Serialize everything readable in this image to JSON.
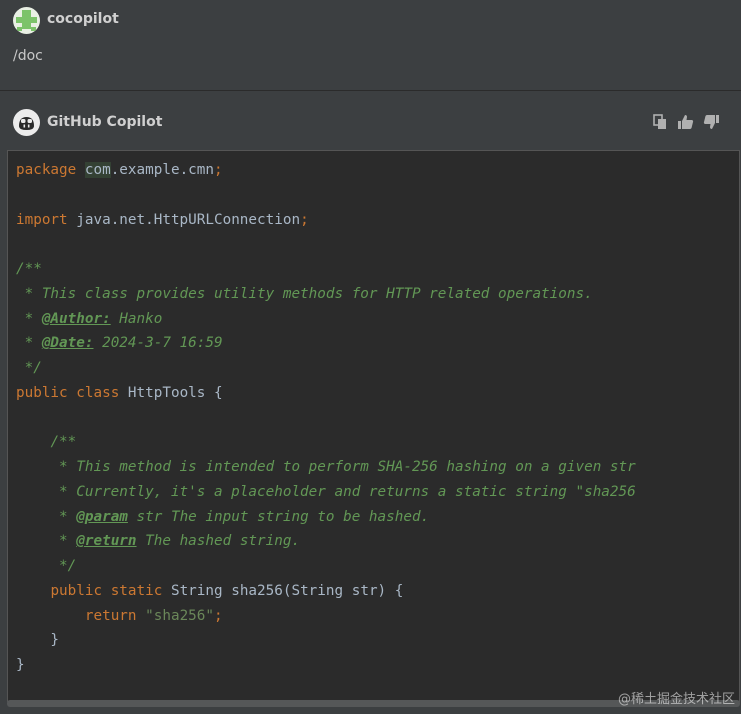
{
  "user": {
    "name": "cocopilot",
    "message": "/doc"
  },
  "assistant": {
    "name": "GitHub Copilot",
    "actions": [
      "copy-icon",
      "thumbs-up-icon",
      "thumbs-down-icon"
    ]
  },
  "code": {
    "language": "java",
    "lines": [
      [
        {
          "t": "package",
          "c": "kw"
        },
        {
          "t": " "
        },
        {
          "t": "com",
          "c": "hl"
        },
        {
          "t": ".example.cmn"
        },
        {
          "t": ";",
          "c": "kw"
        }
      ],
      [],
      [
        {
          "t": "import",
          "c": "kw"
        },
        {
          "t": " java.net.HttpURLConnection"
        },
        {
          "t": ";",
          "c": "kw"
        }
      ],
      [],
      [
        {
          "t": "/**",
          "c": "cm"
        }
      ],
      [
        {
          "t": " * This class provides utility methods for HTTP related operations.",
          "c": "cm"
        }
      ],
      [
        {
          "t": " * ",
          "c": "cm"
        },
        {
          "t": "@Author:",
          "c": "tag"
        },
        {
          "t": " Hanko",
          "c": "cm"
        }
      ],
      [
        {
          "t": " * ",
          "c": "cm"
        },
        {
          "t": "@Date:",
          "c": "tag"
        },
        {
          "t": " 2024-3-7 16:59",
          "c": "cm"
        }
      ],
      [
        {
          "t": " */",
          "c": "cm"
        }
      ],
      [
        {
          "t": "public",
          "c": "kw"
        },
        {
          "t": " "
        },
        {
          "t": "class",
          "c": "kw"
        },
        {
          "t": " HttpTools {"
        }
      ],
      [],
      [
        {
          "t": "    "
        },
        {
          "t": "/**",
          "c": "cm"
        }
      ],
      [
        {
          "t": "     * This method is intended to perform SHA-256 hashing on a given str",
          "c": "cm"
        }
      ],
      [
        {
          "t": "     * Currently, it's a placeholder and returns a static string \"sha256",
          "c": "cm"
        }
      ],
      [
        {
          "t": "     * ",
          "c": "cm"
        },
        {
          "t": "@param",
          "c": "tag"
        },
        {
          "t": " str The input string to be hashed.",
          "c": "cm"
        }
      ],
      [
        {
          "t": "     * ",
          "c": "cm"
        },
        {
          "t": "@return",
          "c": "tag"
        },
        {
          "t": " The hashed string.",
          "c": "cm"
        }
      ],
      [
        {
          "t": "     */",
          "c": "cm"
        }
      ],
      [
        {
          "t": "    "
        },
        {
          "t": "public",
          "c": "kw"
        },
        {
          "t": " "
        },
        {
          "t": "static",
          "c": "kw"
        },
        {
          "t": " String sha256(String str) {"
        }
      ],
      [
        {
          "t": "        "
        },
        {
          "t": "return",
          "c": "kw"
        },
        {
          "t": " "
        },
        {
          "t": "\"sha256\"",
          "c": "str"
        },
        {
          "t": ";",
          "c": "kw"
        }
      ],
      [
        {
          "t": "    }"
        }
      ],
      [
        {
          "t": "}"
        }
      ]
    ]
  },
  "watermark": "@稀土掘金技术社区",
  "colors": {
    "background": "#3c3f41",
    "code_background": "#2b2b2b",
    "keyword": "#cc7832",
    "comment": "#629755",
    "string": "#6a8759",
    "identifier": "#a9b7c6"
  }
}
